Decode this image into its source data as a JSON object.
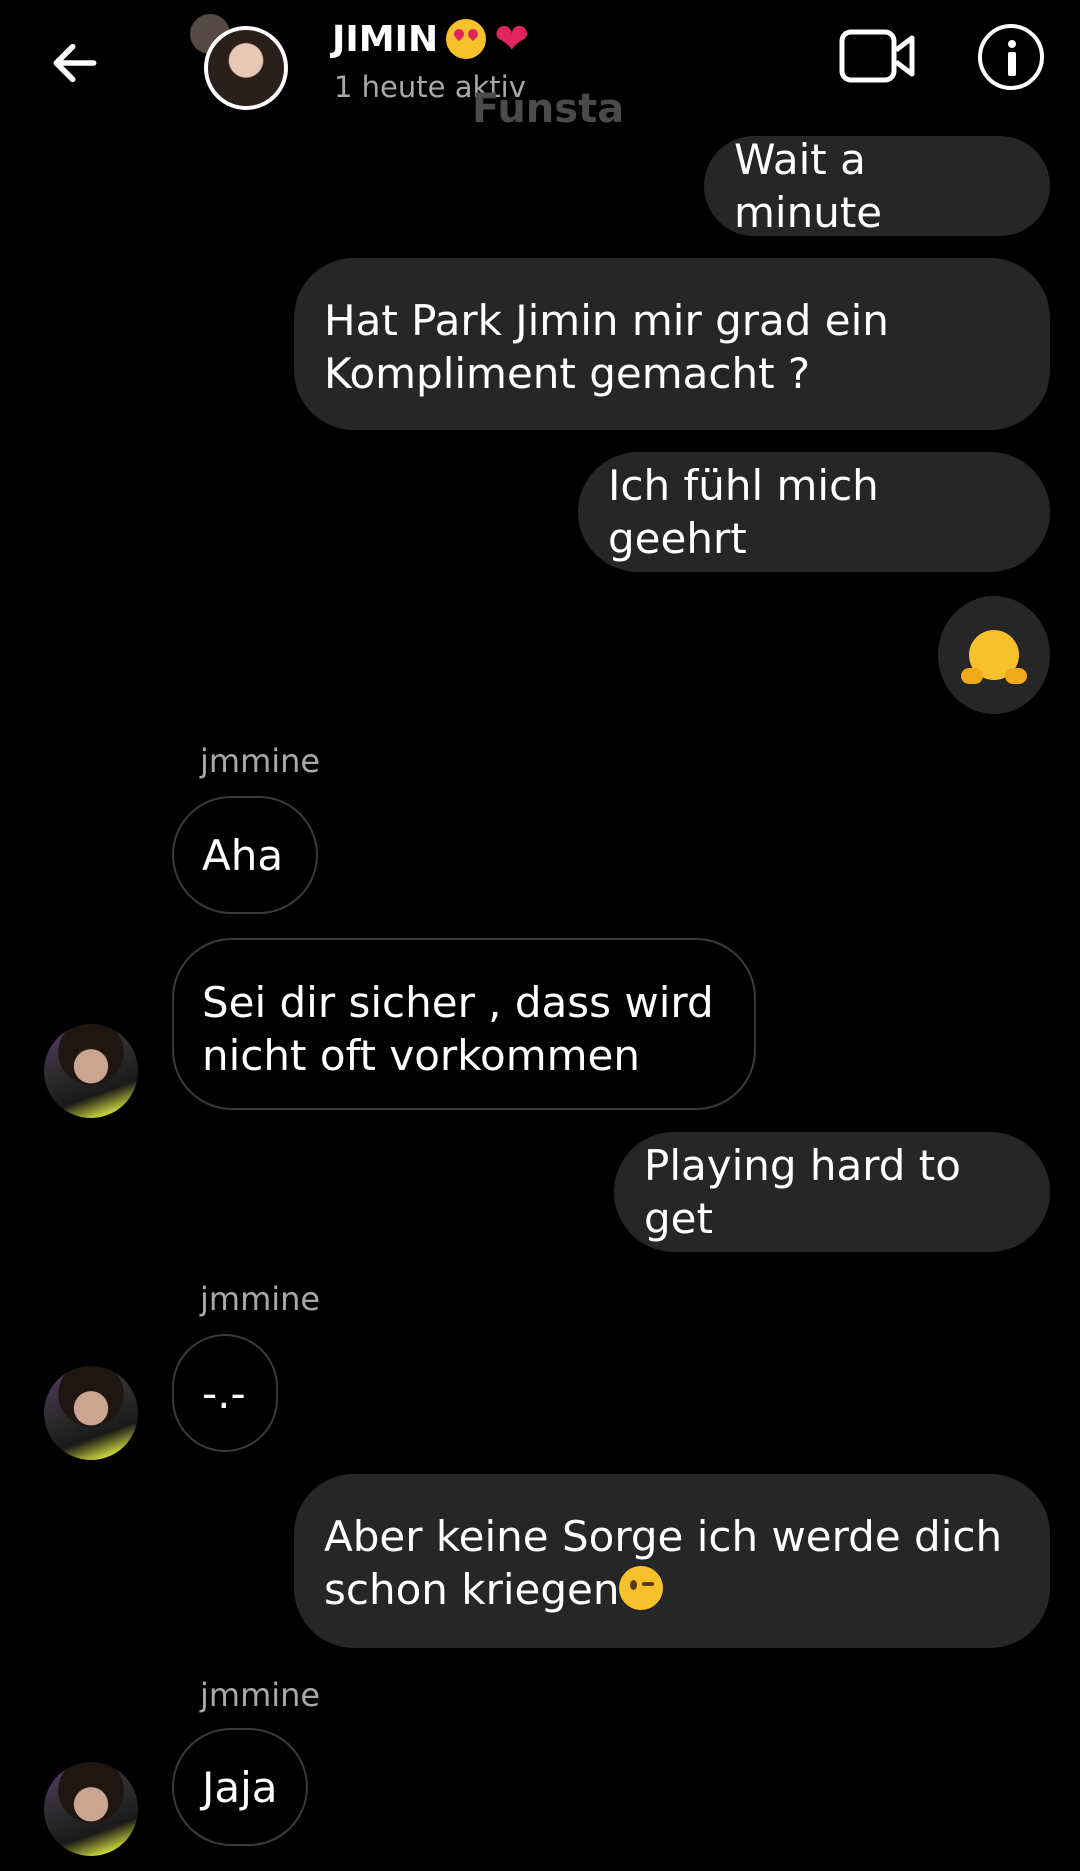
{
  "header": {
    "title": "JIMIN",
    "status": "1 heute aktiv",
    "watermark": "Funsta"
  },
  "icons": {
    "back": "arrow-left-icon",
    "video": "video-camera-icon",
    "info": "info-icon"
  },
  "messages": [
    {
      "from": "me",
      "text": "Wait a minute"
    },
    {
      "from": "me",
      "text": "Hat Park Jimin mir grad ein\nKompliment gemacht ?"
    },
    {
      "from": "me",
      "text": "Ich fühl mich geehrt"
    },
    {
      "from": "me",
      "emoji": "hugging-face"
    },
    {
      "from": "them",
      "sender": "jmmine",
      "text": "Aha"
    },
    {
      "from": "them",
      "text": "Sei dir sicher , dass wird\nnicht oft vorkommen"
    },
    {
      "from": "me",
      "text": "Playing hard to get"
    },
    {
      "from": "them",
      "sender": "jmmine",
      "text": "-.-"
    },
    {
      "from": "me",
      "text": "Aber keine Sorge ich werde dich\nschon kriegen",
      "emoji": "winking-face"
    },
    {
      "from": "them",
      "sender": "jmmine",
      "text": "Jaja"
    }
  ],
  "colors": {
    "background": "#000000",
    "outgoing_bubble": "#262626",
    "incoming_border": "#3a3a3a",
    "secondary_text": "#a8a8a8"
  }
}
